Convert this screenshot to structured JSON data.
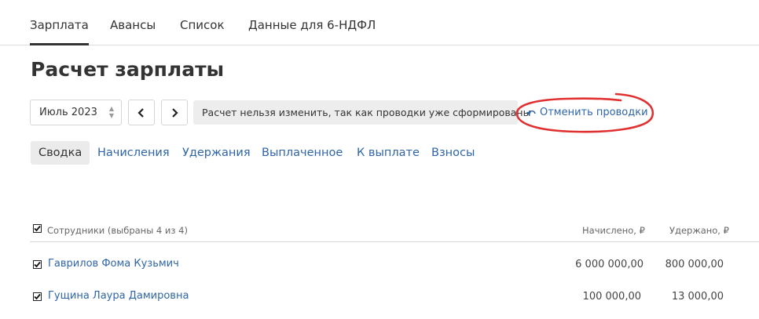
{
  "topnav": {
    "tabs": [
      {
        "label": "Зарплата",
        "active": true
      },
      {
        "label": "Авансы",
        "active": false
      },
      {
        "label": "Список",
        "active": false
      },
      {
        "label": "Данные для 6-НДФЛ",
        "active": false
      }
    ]
  },
  "page": {
    "title": "Расчет зарплаты"
  },
  "period": {
    "value": "Июль 2023"
  },
  "notice": {
    "text": "Расчет нельзя изменить, так как проводки уже сформированы"
  },
  "actions": {
    "cancel_postings": "Отменить проводки"
  },
  "subtabs": [
    {
      "label": "Сводка",
      "active": true
    },
    {
      "label": "Начисления",
      "active": false
    },
    {
      "label": "Удержания",
      "active": false
    },
    {
      "label": "Выплаченное",
      "active": false
    },
    {
      "label": "К выплате",
      "active": false
    },
    {
      "label": "Взносы",
      "active": false
    }
  ],
  "table": {
    "header": {
      "employees": "Сотрудники (выбраны 4 из 4)",
      "accrued": "Начислено, ₽",
      "withheld": "Удержано, ₽"
    },
    "rows": [
      {
        "name": "Гаврилов Фома Кузьмич",
        "accrued": "6 000 000,00",
        "withheld": "800 000,00",
        "checked": true
      },
      {
        "name": "Гущина Лаура Дамировна",
        "accrued": "100 000,00",
        "withheld": "13 000,00",
        "checked": true
      }
    ]
  },
  "colors": {
    "link": "#2f65a8",
    "annotation": "#e03030",
    "active_tab_bg": "#ebebeb"
  },
  "icons": {
    "period_arrows": "up-down-arrows-icon",
    "prev": "chevron-left-icon",
    "next": "chevron-right-icon",
    "cancel": "undo-icon",
    "checkbox": "checkmark-icon"
  }
}
